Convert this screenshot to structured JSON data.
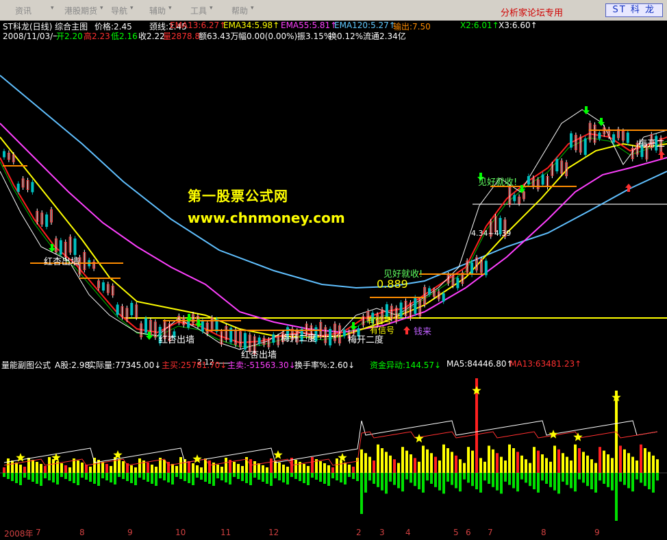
{
  "menu": {
    "items": [
      "资讯",
      "港股期货",
      "导航",
      "辅助",
      "工具",
      "帮助"
    ],
    "forum_label": "分析家论坛专用",
    "stock_box": "ST 科 龙"
  },
  "main_header": {
    "line1": [
      {
        "text": "ST科龙(日线) 综合主图",
        "color": "#ffffff"
      },
      {
        "text": "价格:2.45",
        "color": "#ffffff"
      },
      {
        "text": "颈线:2.45",
        "color": "#ffffff"
      },
      {
        "text": "EMA13:6.27↑",
        "color": "#ff3030"
      },
      {
        "text": "EMA34:5.98↑",
        "color": "#ffff00"
      },
      {
        "text": "EMA55:5.81↑",
        "color": "#ff40ff"
      },
      {
        "text": "EMA120:5.27↑",
        "color": "#60c8ff"
      },
      {
        "text": "输出:7.50",
        "color": "#ff8c00"
      },
      {
        "text": "X2:6.01↑",
        "color": "#00ff00"
      },
      {
        "text": "X3:6.60↑",
        "color": "#ffffff"
      }
    ],
    "line2": [
      {
        "text": "2008/11/03/一",
        "color": "#ffffff"
      },
      {
        "text": "开2.20",
        "color": "#00ff00"
      },
      {
        "text": "高2.23",
        "color": "#ff3030"
      },
      {
        "text": "低2.16",
        "color": "#00ff00"
      },
      {
        "text": "收2.22",
        "color": "#ffffff"
      },
      {
        "text": "量2878.8",
        "color": "#ff3030"
      },
      {
        "text": "额63.43万",
        "color": "#ffffff"
      },
      {
        "text": "幅0.00(0.00%)",
        "color": "#ffffff"
      },
      {
        "text": "振3.15%",
        "color": "#ffffff"
      },
      {
        "text": "换0.12%",
        "color": "#ffffff"
      },
      {
        "text": "流通2.34亿",
        "color": "#ffffff"
      }
    ]
  },
  "watermark": {
    "line1": "第一股票公式网",
    "line2": "www.chnmoney.com"
  },
  "annotations": {
    "hongxing": "红杏出墙",
    "jianhao": "见好就收!",
    "meikai": "梅开二度",
    "youxinhao": "有信号",
    "qianlai": "钱来",
    "range_label": "4.34~4.39",
    "low_label": "2.12",
    "big_digits": "0.889",
    "lipizzaner": "梅开二"
  },
  "sub_header": [
    {
      "text": "量能副图公式",
      "color": "#ffffff"
    },
    {
      "text": "A股:2.98",
      "color": "#ffffff"
    },
    {
      "text": "实际量:77345.00↓",
      "color": "#ffffff"
    },
    {
      "text": "主买:25781.70↓",
      "color": "#ff3030"
    },
    {
      "text": "主卖:-51563.30↓",
      "color": "#ff40ff"
    },
    {
      "text": "换手率%:2.60↓",
      "color": "#ffffff"
    },
    {
      "text": "资金异动:144.57↓",
      "color": "#00ff00"
    },
    {
      "text": "MA5:84446.80↑",
      "color": "#ffffff"
    },
    {
      "text": "MA13:63481.23↑",
      "color": "#ff3030"
    }
  ],
  "x_axis": {
    "labels": [
      "2008年",
      "7",
      "8",
      "9",
      "10",
      "11",
      "12",
      "2",
      "3",
      "4",
      "5",
      "6",
      "7",
      "8",
      "9"
    ]
  },
  "colors": {
    "ema13": "#ff2020",
    "ema34": "#ffff00",
    "ema55": "#ff40ff",
    "ema120": "#60c0ff",
    "output": "#ff8c00",
    "neckline": "#ffff00",
    "up_arrow": "#ff3030",
    "down_arrow": "#00ff00"
  }
}
